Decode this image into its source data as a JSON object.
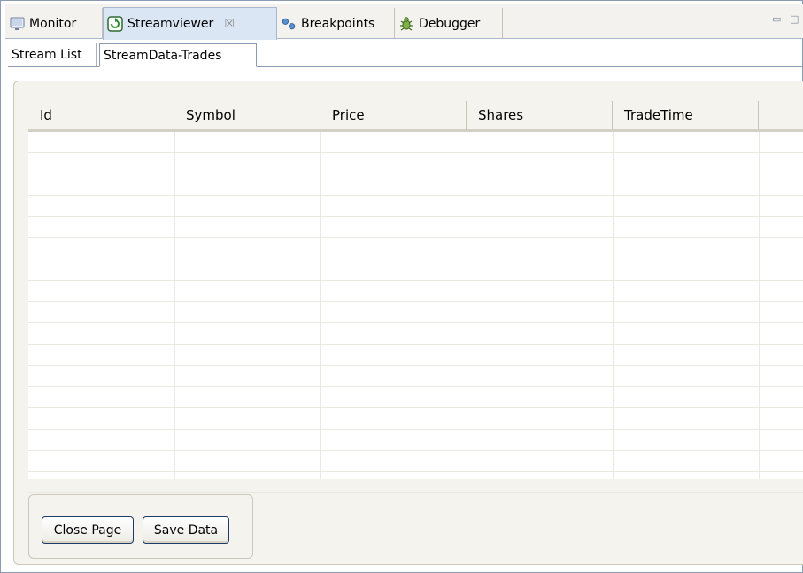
{
  "view_tabs": [
    {
      "label": "Monitor",
      "icon": "monitor-icon"
    },
    {
      "label": "Streamviewer",
      "icon": "streamviewer-icon",
      "active": true,
      "close": "☒"
    },
    {
      "label": "Breakpoints",
      "icon": "breakpoints-icon"
    },
    {
      "label": "Debugger",
      "icon": "debugger-icon"
    }
  ],
  "window_controls": {
    "minimize": "▭",
    "maximize": "□"
  },
  "sub_tabs": [
    {
      "label": "Stream List"
    },
    {
      "label": "StreamData-Trades",
      "active": true
    }
  ],
  "table": {
    "columns": [
      "Id",
      "Symbol",
      "Price",
      "Shares",
      "TradeTime"
    ],
    "row_count": 17
  },
  "buttons": {
    "close_page": "Close Page",
    "save_data": "Save Data"
  },
  "colors": {
    "active_tab_bg": "#dbe6f5",
    "panel_bg": "#f4f3ee",
    "button_border": "#1e3a68"
  }
}
